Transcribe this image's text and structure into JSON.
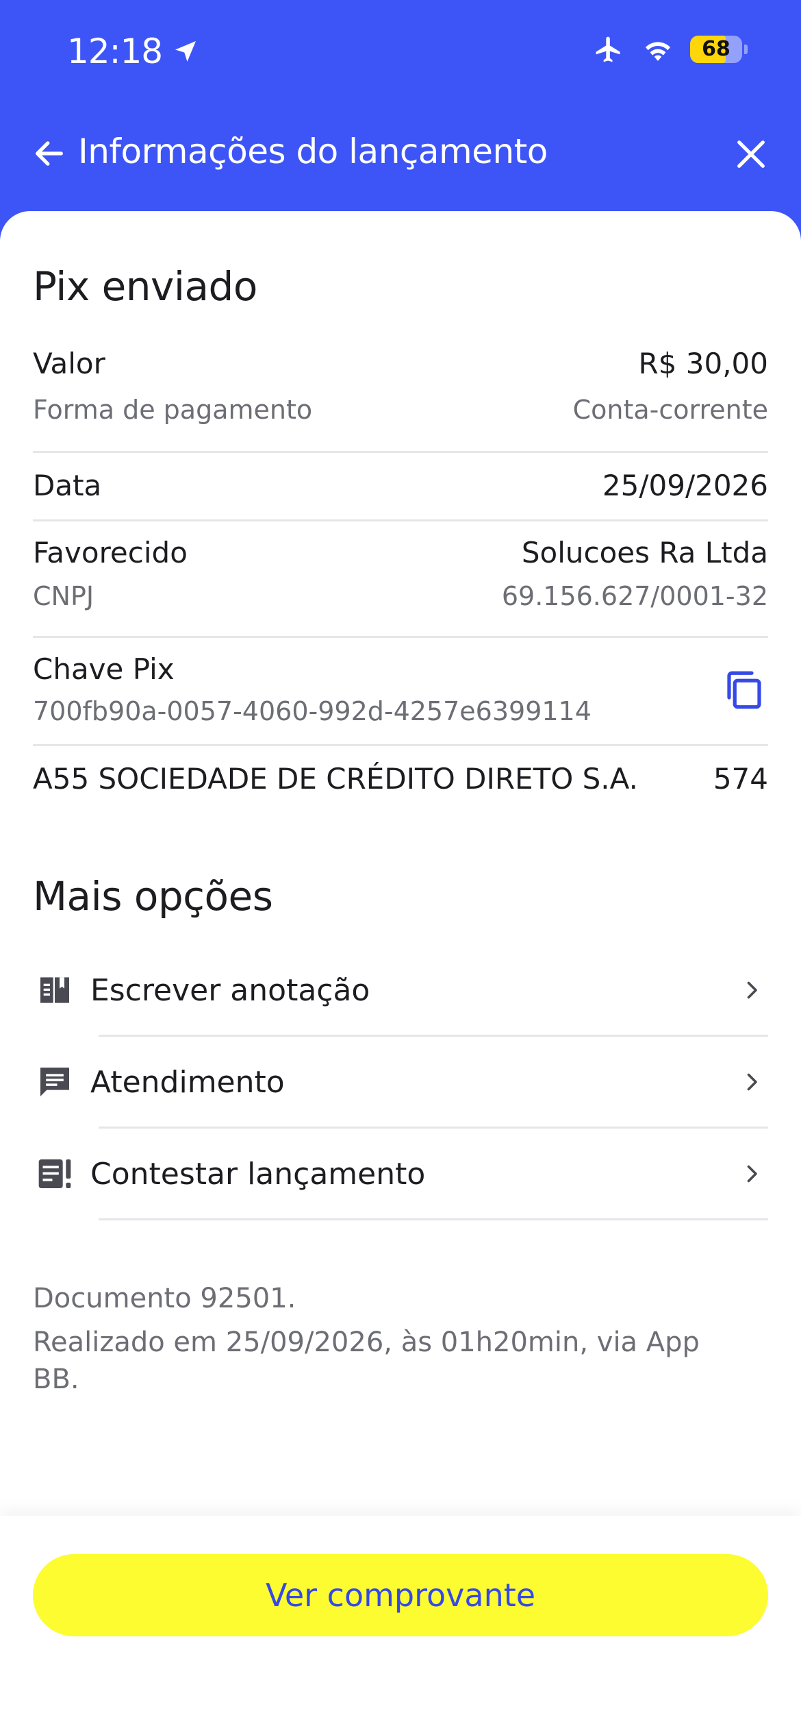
{
  "status_bar": {
    "time": "12:18",
    "battery_level": "68",
    "battery_fraction": 0.68
  },
  "header": {
    "title": "Informações do lançamento"
  },
  "details": {
    "title": "Pix enviado",
    "valor_label": "Valor",
    "valor_value": "R$ 30,00",
    "forma_label": "Forma de pagamento",
    "forma_value": "Conta-corrente",
    "data_label": "Data",
    "data_value": "25/09/2026",
    "favorecido_label": "Favorecido",
    "favorecido_value": "Solucoes Ra Ltda",
    "cnpj_label": "CNPJ",
    "cnpj_value": "69.156.627/0001-32",
    "chave_label": "Chave Pix",
    "chave_value": "700fb90a-0057-4060-992d-4257e6399114",
    "bank_name": "A55 SOCIEDADE DE CRÉDITO DIRETO S.A.",
    "bank_code": "574"
  },
  "options": {
    "title": "Mais opções",
    "items": [
      {
        "label": "Escrever anotação",
        "icon": "note-icon"
      },
      {
        "label": "Atendimento",
        "icon": "chat-icon"
      },
      {
        "label": "Contestar lançamento",
        "icon": "report-icon"
      }
    ]
  },
  "footer": {
    "documento": "Documento 92501.",
    "realizado": "Realizado em 25/09/2026, às 01h20min, via App BB."
  },
  "actions": {
    "ver_comprovante": "Ver comprovante"
  },
  "colors": {
    "brand_blue": "#3d55f7",
    "button_yellow": "#fcfc30",
    "icon_blue": "#3549e6"
  }
}
